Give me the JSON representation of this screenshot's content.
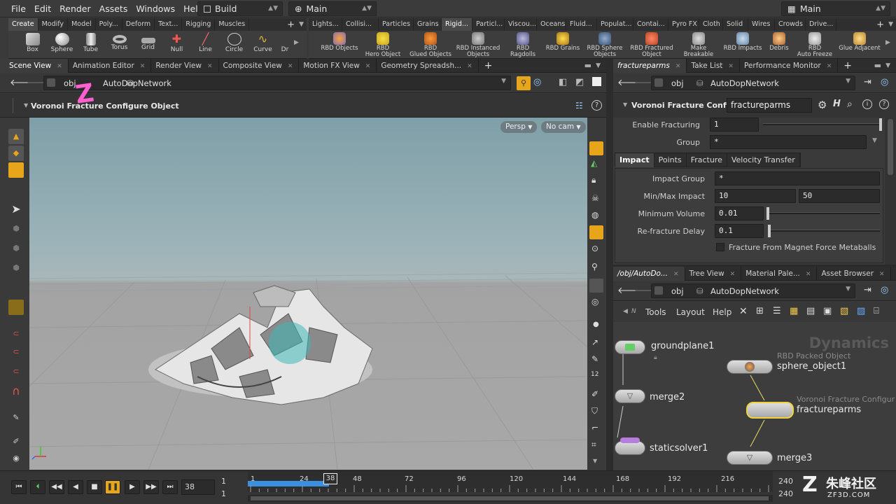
{
  "menubar": {
    "items": [
      "File",
      "Edit",
      "Render",
      "Assets",
      "Windows",
      "Help"
    ],
    "desktop_left": "Build",
    "desktop_center": "Main",
    "desktop_right": "Main"
  },
  "shelf_left": {
    "tabs": [
      "Create",
      "Modify",
      "Model",
      "Poly...",
      "Deform",
      "Text...",
      "Rigging",
      "Muscles"
    ],
    "tools": [
      "Box",
      "Sphere",
      "Tube",
      "Torus",
      "Grid",
      "Null",
      "Line",
      "Circle",
      "Curve",
      "Dr"
    ]
  },
  "shelf_right": {
    "tabs": [
      "Lights...",
      "Collisi...",
      "Particles",
      "Grains",
      "Rigid...",
      "Particl...",
      "Viscou...",
      "Oceans",
      "Fluid...",
      "Populat...",
      "Contai...",
      "Pyro FX",
      "Cloth",
      "Solid",
      "Wires",
      "Crowds",
      "Drive..."
    ],
    "tools": [
      {
        "l1": "RBD Objects",
        "l2": ""
      },
      {
        "l1": "RBD",
        "l2": "Hero Object"
      },
      {
        "l1": "RBD",
        "l2": "Glued Objects"
      },
      {
        "l1": "RBD Instanced",
        "l2": "Objects"
      },
      {
        "l1": "RBD Ragdolls",
        "l2": ""
      },
      {
        "l1": "RBD Grains",
        "l2": ""
      },
      {
        "l1": "RBD Sphere",
        "l2": "Objects"
      },
      {
        "l1": "RBD Fractured",
        "l2": "Object"
      },
      {
        "l1": "Make",
        "l2": "Breakable"
      },
      {
        "l1": "RBD Impacts",
        "l2": ""
      },
      {
        "l1": "Debris",
        "l2": ""
      },
      {
        "l1": "RBD",
        "l2": "Auto Freeze"
      },
      {
        "l1": "Glue Adjacent",
        "l2": ""
      }
    ]
  },
  "left_pane": {
    "tabs": [
      "Scene View",
      "Animation Editor",
      "Render View",
      "Composite View",
      "Motion FX View",
      "Geometry Spreadsh..."
    ],
    "path_root": "obj",
    "path_node": "AutoDopNetwork",
    "operation": "Voronoi Fracture Configure Object",
    "persp": "Persp",
    "cam": "No cam"
  },
  "param_pane": {
    "tabs": [
      "fractureparms",
      "Take List",
      "Performance Monitor"
    ],
    "path_root": "obj",
    "path_node": "AutoDopNetwork",
    "node_type": "Voronoi Fracture Confi...",
    "node_name": "fractureparms",
    "enable_label": "Enable Fracturing",
    "enable_value": "1",
    "group_label": "Group",
    "group_value": "*",
    "subtabs": [
      "Impact",
      "Points",
      "Fracture",
      "Velocity Transfer"
    ],
    "impact_group_label": "Impact Group",
    "impact_group_value": "*",
    "minmax_label": "Min/Max Impact",
    "min_value": "10",
    "max_value": "50",
    "minvol_label": "Minimum Volume",
    "minvol_value": "0.01",
    "refract_label": "Re-fracture Delay",
    "refract_value": "0.1",
    "magnet_label": "Fracture From Magnet Force Metaballs"
  },
  "net_pane": {
    "tabs": [
      "/obj/AutoDo...",
      "Tree View",
      "Material Pale...",
      "Asset Browser"
    ],
    "path_root": "obj",
    "path_node": "AutoDopNetwork",
    "menu": [
      "Tools",
      "Layout",
      "Help"
    ],
    "context": "Dynamics",
    "nodes": {
      "groundplane": "groundplane1",
      "merge2": "merge2",
      "staticsolver": "staticsolver1",
      "sphere_type": "RBD Packed Object",
      "sphere": "sphere_object1",
      "fracture_type": "Voronoi Fracture Configur",
      "fracture": "fractureparms",
      "merge3": "merge3"
    }
  },
  "timeline": {
    "start": "1",
    "end": "1",
    "current_frame": "38",
    "ticks": [
      "1",
      "24",
      "38",
      "48",
      "72",
      "96",
      "120",
      "144",
      "168",
      "192",
      "216",
      "240"
    ],
    "range_end_top": "240",
    "range_end_bottom": "240",
    "frame_fraction": 0.154
  },
  "watermark": "ZF3D.COM",
  "watermark_cn": "朱峰社区",
  "colors": {
    "accent": "#e6a51a",
    "selected_node": "#f0d23c",
    "timeline_blue": "#3a8fdf"
  }
}
